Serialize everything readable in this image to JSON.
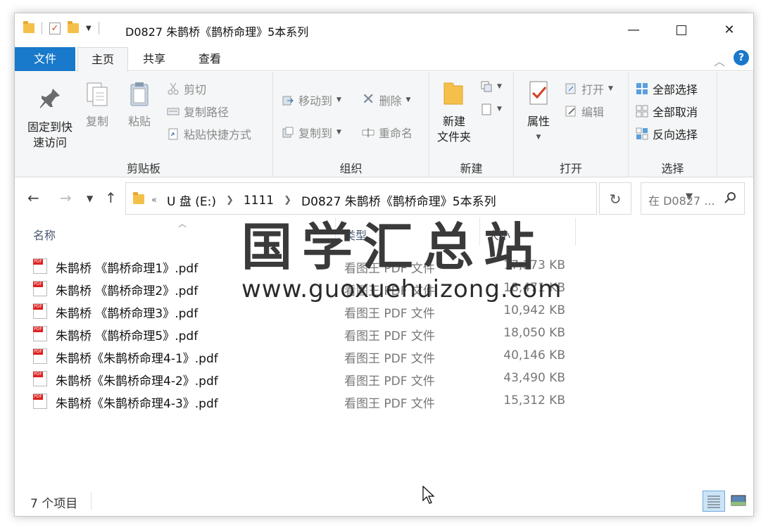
{
  "window": {
    "title": "D0827 朱鹊桥《鹊桥命理》5本系列",
    "controls": {
      "minimize": "—",
      "close": "✕"
    }
  },
  "tabs": [
    "文件",
    "主页",
    "共享",
    "查看"
  ],
  "ribbon": {
    "clipboard": {
      "label": "剪贴板",
      "pin": "固定到快\n速访问",
      "copy": "复制",
      "paste": "粘贴",
      "cut": "剪切",
      "copy_path": "复制路径",
      "paste_shortcut": "粘贴快捷方式"
    },
    "organize": {
      "label": "组织",
      "move_to": "移动到",
      "copy_to": "复制到",
      "delete": "删除",
      "rename": "重命名"
    },
    "new": {
      "label": "新建",
      "new_folder": "新建\n文件夹"
    },
    "open": {
      "label": "打开",
      "properties": "属性",
      "open": "打开",
      "edit": "编辑"
    },
    "select": {
      "label": "选择",
      "select_all": "全部选择",
      "select_none": "全部取消",
      "invert": "反向选择"
    }
  },
  "address": {
    "overflow": "«",
    "crumbs": [
      "U 盘 (E:)",
      "1111",
      "D0827 朱鹊桥《鹊桥命理》5本系列"
    ],
    "search_placeholder": "在 D0827 ..."
  },
  "columns": {
    "name": "名称",
    "type": "类型",
    "size": "大小"
  },
  "files": [
    {
      "name": "朱鹊桥 《鹊桥命理1》.pdf",
      "type": "看图王 PDF 文件",
      "size": "17,373 KB"
    },
    {
      "name": "朱鹊桥 《鹊桥命理2》.pdf",
      "type": "看图王 PDF 文件",
      "size": "18,471 KB"
    },
    {
      "name": "朱鹊桥 《鹊桥命理3》.pdf",
      "type": "看图王 PDF 文件",
      "size": "10,942 KB"
    },
    {
      "name": "朱鹊桥 《鹊桥命理5》.pdf",
      "type": "看图王 PDF 文件",
      "size": "18,050 KB"
    },
    {
      "name": "朱鹊桥《朱鹊桥命理4-1》.pdf",
      "type": "看图王 PDF 文件",
      "size": "40,146 KB"
    },
    {
      "name": "朱鹊桥《朱鹊桥命理4-2》.pdf",
      "type": "看图王 PDF 文件",
      "size": "43,490 KB"
    },
    {
      "name": "朱鹊桥《朱鹊桥命理4-3》.pdf",
      "type": "看图王 PDF 文件",
      "size": "15,312 KB"
    }
  ],
  "status": {
    "count": "7 个项目"
  },
  "watermark": {
    "title": "国学汇总站",
    "url": "www.guoxuehuizong.com"
  },
  "colors": {
    "accent": "#1979ca",
    "pdf_red": "#e02020",
    "folder": "#f5c04a"
  }
}
